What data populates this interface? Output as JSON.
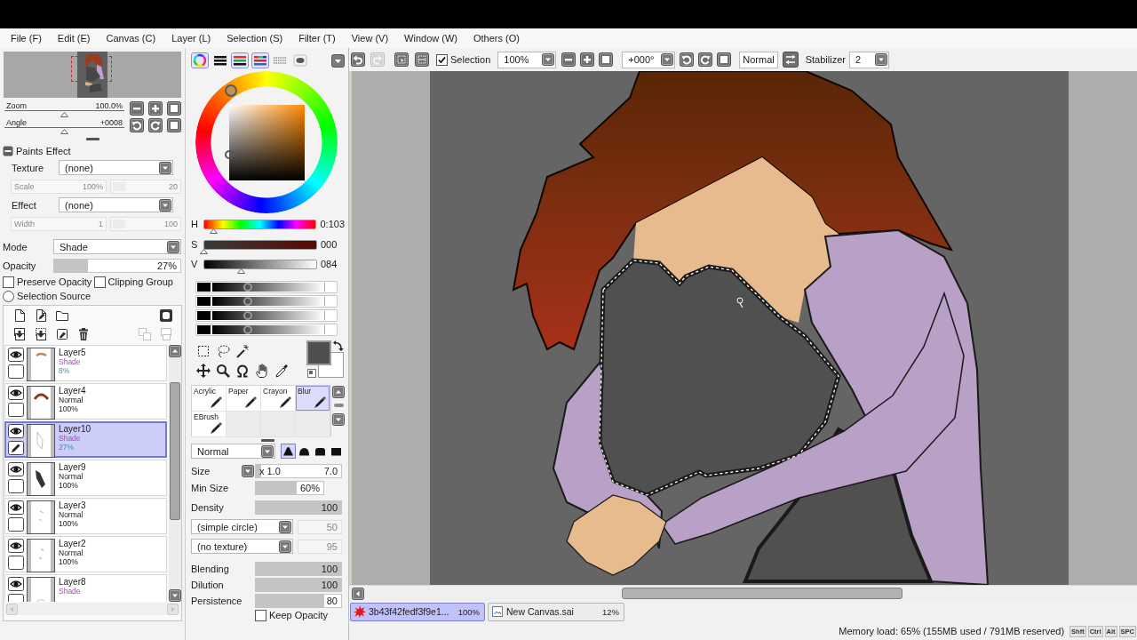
{
  "menu": [
    "File (F)",
    "Edit (E)",
    "Canvas (C)",
    "Layer (L)",
    "Selection (S)",
    "Filter (T)",
    "View (V)",
    "Window (W)",
    "Others (O)"
  ],
  "navigator": {
    "zoom": {
      "label": "Zoom",
      "value": "100.0%",
      "level": 0.5
    },
    "angle": {
      "label": "Angle",
      "value": "+0008",
      "level": 0.5
    }
  },
  "paints_effect": {
    "title": "Paints Effect",
    "expanded": true,
    "texture": {
      "label": "Texture",
      "value": "(none)"
    },
    "scale": {
      "label": "Scale",
      "value": "100%",
      "amount": "20",
      "disabled": true
    },
    "effect": {
      "label": "Effect",
      "value": "(none)"
    },
    "width": {
      "label": "Width",
      "value": "1",
      "amount": "100",
      "disabled": true
    }
  },
  "layer_settings": {
    "mode": {
      "label": "Mode",
      "value": "Shade"
    },
    "opacity": {
      "label": "Opacity",
      "value": "27%",
      "level": 0.27
    },
    "options": [
      {
        "label": "Preserve Opacity",
        "checked": false
      },
      {
        "label": "Clipping Group",
        "checked": false
      }
    ],
    "selection_source": {
      "label": "Selection Source",
      "selected": false
    }
  },
  "layer_tools": {
    "top": [
      {
        "kind": "page",
        "disabled": false
      },
      {
        "kind": "linework",
        "disabled": false
      },
      {
        "kind": "folder",
        "disabled": false
      },
      {
        "kind": "mask",
        "disabled": false
      }
    ],
    "bottom": [
      {
        "kind": "transfer",
        "disabled": false
      },
      {
        "kind": "merge",
        "disabled": false
      },
      {
        "kind": "clear",
        "disabled": false
      },
      {
        "kind": "delete",
        "disabled": false
      },
      {
        "kind": "combine",
        "disabled": true
      },
      {
        "kind": "stack",
        "disabled": true
      }
    ]
  },
  "layers": [
    {
      "name": "Layer5",
      "mode": "Shade",
      "opacity": "8%",
      "kind": "shade",
      "opacity_reduced": true,
      "visible": true,
      "selected": false
    },
    {
      "name": "Layer4",
      "mode": "Normal",
      "opacity": "100%",
      "kind": "normal",
      "opacity_reduced": false,
      "visible": true,
      "selected": false
    },
    {
      "name": "Layer10",
      "mode": "Shade",
      "opacity": "27%",
      "kind": "shade",
      "opacity_reduced": true,
      "visible": true,
      "selected": true
    },
    {
      "name": "Layer9",
      "mode": "Normal",
      "opacity": "100%",
      "kind": "normal",
      "opacity_reduced": false,
      "visible": true,
      "selected": false
    },
    {
      "name": "Layer3",
      "mode": "Normal",
      "opacity": "100%",
      "kind": "normal",
      "opacity_reduced": false,
      "visible": true,
      "selected": false
    },
    {
      "name": "Layer2",
      "mode": "Normal",
      "opacity": "100%",
      "kind": "normal",
      "opacity_reduced": false,
      "visible": true,
      "selected": false
    },
    {
      "name": "Layer8",
      "mode": "Shade",
      "kind": "shade",
      "visible": true,
      "selected": false
    }
  ],
  "color_panel": {
    "modes": [
      {
        "kind": "wheel",
        "selected": true
      },
      {
        "kind": "bars",
        "selected": false
      },
      {
        "kind": "rgb",
        "selected": true
      },
      {
        "kind": "hsv",
        "selected": true
      },
      {
        "kind": "swatches",
        "selected": false
      },
      {
        "kind": "scratchpad",
        "selected": false
      }
    ],
    "hsv": [
      {
        "kind": "hue",
        "label": "H",
        "value": "0:103",
        "level": 0.09
      },
      {
        "kind": "saturation",
        "label": "S",
        "value": "000",
        "level": 0
      },
      {
        "kind": "value",
        "label": "V",
        "value": "084",
        "level": 0.33
      }
    ],
    "gray_sliders": [
      {
        "level": 0.32
      },
      {
        "level": 0.32
      },
      {
        "level": 0.32
      },
      {
        "level": 0.32
      }
    ]
  },
  "brushes": [
    {
      "label": "Acrylic",
      "selected": false
    },
    {
      "label": "Paper",
      "selected": false
    },
    {
      "label": "Crayon",
      "selected": false
    },
    {
      "label": "Blur",
      "selected": true
    },
    {
      "label": "EBrush",
      "selected": false
    }
  ],
  "brush_settings": {
    "blend": "Normal",
    "shapes": [
      {
        "selected": true
      },
      {
        "selected": false
      },
      {
        "selected": false
      },
      {
        "selected": false
      }
    ],
    "size": {
      "label": "Size",
      "scale": "x 1.0",
      "value": "7.0",
      "level": 0.06
    },
    "min_size": {
      "label": "Min Size",
      "value": "60%",
      "level": 0.6
    },
    "density": {
      "label": "Density",
      "value": "100",
      "level": 1
    },
    "shape": {
      "value": "(simple circle)",
      "amount": {
        "value": "50",
        "disabled": true
      }
    },
    "texture": {
      "value": "(no texture)",
      "amount": {
        "value": "95",
        "disabled": true
      }
    },
    "blending": {
      "label": "Blending",
      "value": "100",
      "level": 1
    },
    "dilution": {
      "label": "Dilution",
      "value": "100",
      "level": 1
    },
    "persistence": {
      "label": "Persistence",
      "value": "80",
      "level": 0.8
    },
    "keep_opacity": {
      "label": "Keep Opacity",
      "checked": false
    }
  },
  "toolbar": {
    "undo": {
      "disabled": false
    },
    "redo": {
      "disabled": true
    },
    "selection": {
      "label": "Selection",
      "checked": true
    },
    "zoom": "100%",
    "angle": "+000°",
    "view_mode": "Normal",
    "stabilizer": {
      "label": "Stabilizer",
      "value": "2"
    }
  },
  "documents": [
    {
      "kind": "image",
      "name": "3b43f42fedf3f9e1...",
      "zoom": "100%",
      "selected": true
    },
    {
      "kind": "file",
      "name": "New Canvas.sai",
      "zoom": "12%",
      "selected": false
    }
  ],
  "status": {
    "memory": "Memory load: 65% (155MB used / 791MB reserved)",
    "keys": [
      "Shft",
      "Ctrl",
      "Alt",
      "SPC"
    ]
  }
}
